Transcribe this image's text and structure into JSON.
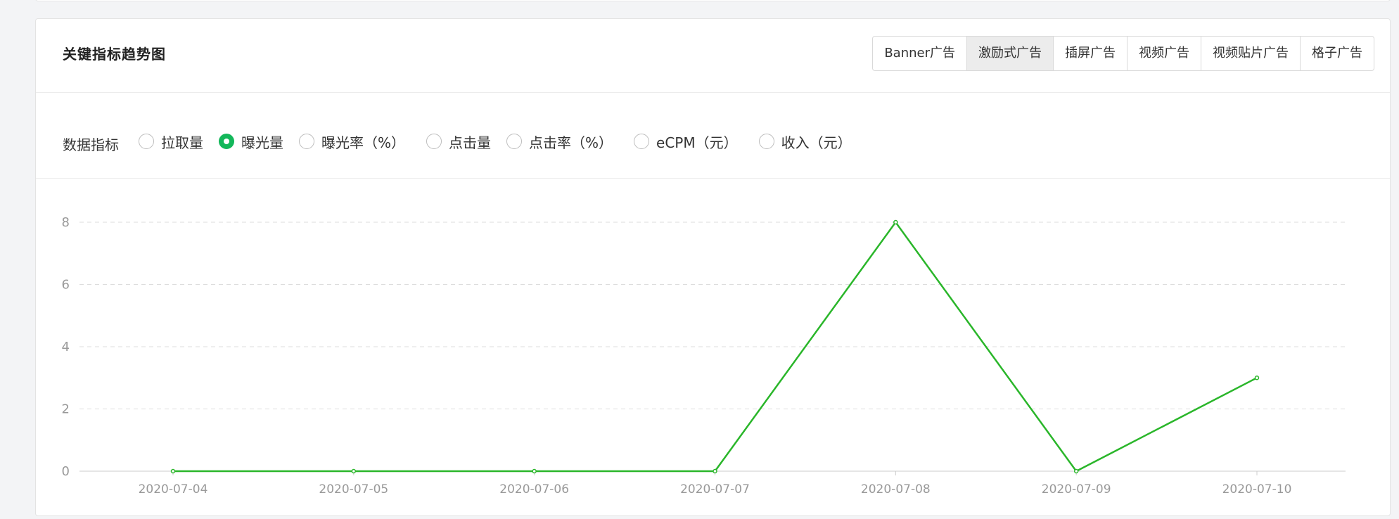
{
  "card": {
    "title": "关键指标趋势图"
  },
  "tabs": [
    {
      "label": "Banner广告",
      "active": false
    },
    {
      "label": "激励式广告",
      "active": true
    },
    {
      "label": "插屏广告",
      "active": false
    },
    {
      "label": "视频广告",
      "active": false
    },
    {
      "label": "视频贴片广告",
      "active": false
    },
    {
      "label": "格子广告",
      "active": false
    }
  ],
  "filters": {
    "label": "数据指标",
    "options": [
      {
        "label": "拉取量",
        "checked": false
      },
      {
        "label": "曝光量",
        "checked": true
      },
      {
        "label": "曝光率（%）",
        "checked": false
      },
      {
        "label": "点击量",
        "checked": false
      },
      {
        "label": "点击率（%）",
        "checked": false
      },
      {
        "label": "eCPM（元）",
        "checked": false
      },
      {
        "label": "收入（元）",
        "checked": false
      }
    ]
  },
  "colors": {
    "accent": "#13b75a",
    "line": "#2ab62a",
    "grid": "#dddddd",
    "axis_text": "#999999"
  },
  "chart_data": {
    "type": "line",
    "x": [
      "2020-07-04",
      "2020-07-05",
      "2020-07-06",
      "2020-07-07",
      "2020-07-08",
      "2020-07-09",
      "2020-07-10"
    ],
    "series": [
      {
        "values": [
          0,
          0,
          0,
          0,
          8,
          0,
          3
        ]
      }
    ],
    "yticks": [
      0,
      2,
      4,
      6,
      8
    ],
    "ylim": [
      0,
      8
    ],
    "grid": true,
    "title": "",
    "xlabel": "",
    "ylabel": ""
  }
}
